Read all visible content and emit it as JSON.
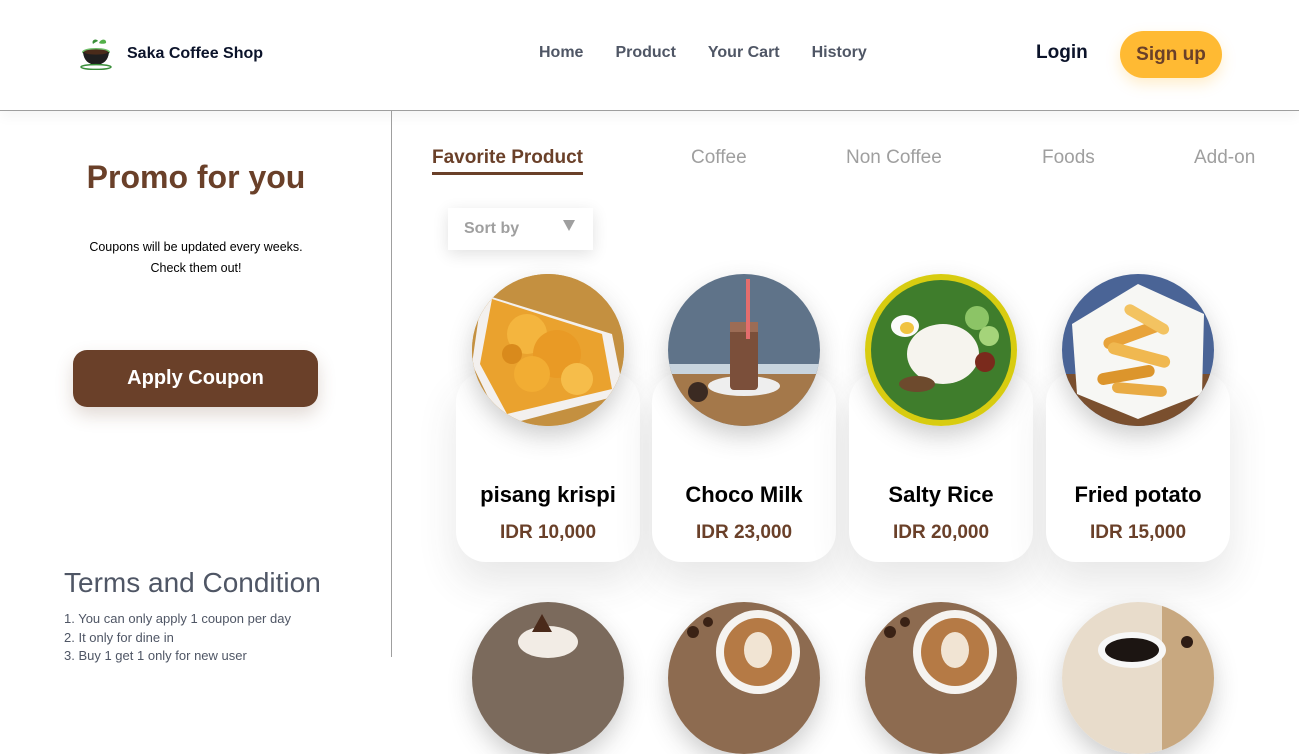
{
  "header": {
    "brand": "Saka Coffee Shop",
    "nav": [
      "Home",
      "Product",
      "Your Cart",
      "History"
    ],
    "login": "Login",
    "signup": "Sign up"
  },
  "sidebar": {
    "promo_title": "Promo for you",
    "promo_desc_line1": "Coupons will be updated every weeks.",
    "promo_desc_line2": "Check them out!",
    "apply_button": "Apply Coupon",
    "terms_title": "Terms and Condition",
    "terms": [
      "1. You can only apply 1 coupon per day",
      "2. It only for dine in",
      "3. Buy 1 get 1 only for new user"
    ]
  },
  "main": {
    "tabs": [
      "Favorite Product",
      "Coffee",
      "Non Coffee",
      "Foods",
      "Add-on"
    ],
    "active_tab": "Favorite Product",
    "sort_label": "Sort by",
    "products": [
      {
        "name": "pisang krispi",
        "price": "IDR 10,000"
      },
      {
        "name": "Choco Milk",
        "price": "IDR 23,000"
      },
      {
        "name": "Salty Rice",
        "price": "IDR 20,000"
      },
      {
        "name": "Fried potato",
        "price": "IDR 15,000"
      }
    ]
  },
  "colors": {
    "brand_brown": "#6a4029",
    "accent_yellow": "#ffba33",
    "muted_text": "#9f9f9f",
    "nav_text": "#4f5665"
  }
}
